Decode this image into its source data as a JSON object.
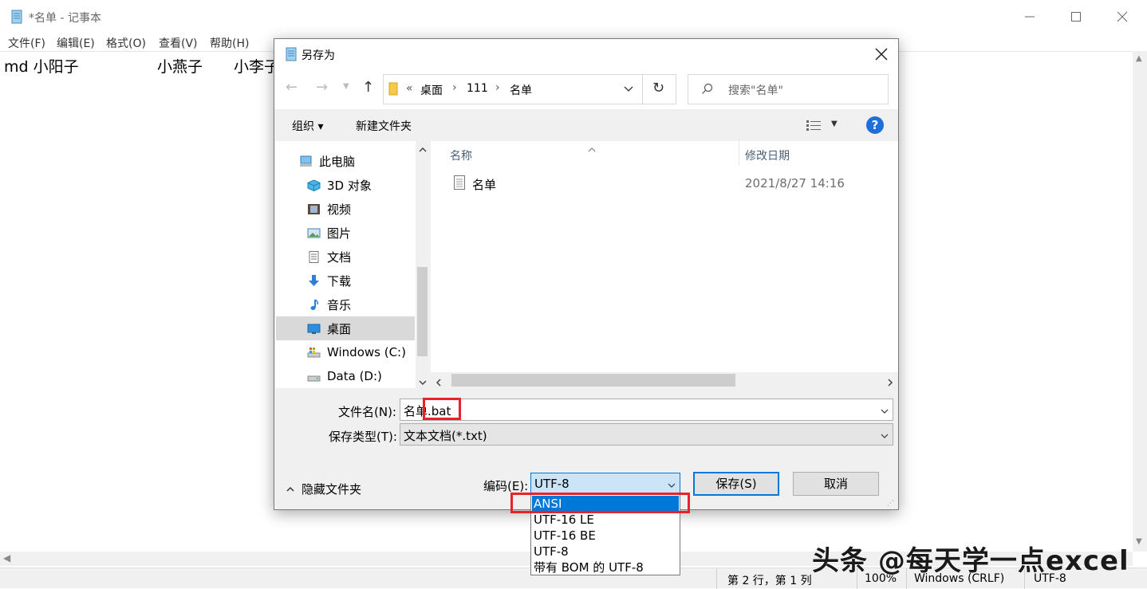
{
  "notepad": {
    "title": "*名单 - 记事本",
    "menu": [
      "文件(F)",
      "编辑(E)",
      "格式(O)",
      "查看(V)",
      "帮助(H)"
    ],
    "text_cells": [
      "md 小阳子",
      "小燕子",
      "小李子"
    ],
    "status": {
      "position": "第 2 行，第 1 列",
      "zoom": "100%",
      "line_ending": "Windows (CRLF)",
      "encoding": "UTF-8"
    }
  },
  "dialog": {
    "title": "另存为",
    "address": {
      "overflow": "«",
      "crumbs": [
        "桌面",
        "111",
        "名单"
      ]
    },
    "search_placeholder": "搜索\"名单\"",
    "toolbar": {
      "organize": "组织 ▾",
      "new_folder": "新建文件夹"
    },
    "nav_items": [
      {
        "label": "此电脑",
        "icon": "computer-icon"
      },
      {
        "label": "3D 对象",
        "icon": "cube-3d-icon"
      },
      {
        "label": "视频",
        "icon": "video-icon"
      },
      {
        "label": "图片",
        "icon": "picture-icon"
      },
      {
        "label": "文档",
        "icon": "document-icon"
      },
      {
        "label": "下载",
        "icon": "download-icon"
      },
      {
        "label": "音乐",
        "icon": "music-icon"
      },
      {
        "label": "桌面",
        "icon": "desktop-icon"
      },
      {
        "label": "Windows (C:)",
        "icon": "drive-c-icon"
      },
      {
        "label": "Data (D:)",
        "icon": "drive-d-icon"
      }
    ],
    "selected_nav": "桌面",
    "columns": {
      "name": "名称",
      "modified": "修改日期"
    },
    "files": [
      {
        "name": "名单",
        "modified": "2021/8/27 14:16"
      }
    ],
    "filename_label": "文件名(N):",
    "filename_value": "名单.bat",
    "filename_value_parts": [
      "名单",
      ".bat"
    ],
    "filetype_label": "保存类型(T):",
    "filetype_value": "文本文档(*.txt)",
    "hide_folders": "隐藏文件夹",
    "encoding_label": "编码(E):",
    "encoding_value": "UTF-8",
    "encoding_options": [
      "ANSI",
      "UTF-16 LE",
      "UTF-16 BE",
      "UTF-8",
      "带有 BOM 的 UTF-8"
    ],
    "highlighted_option": "ANSI",
    "save_button": "保存(S)",
    "cancel_button": "取消"
  },
  "watermark": "头条 @每天学一点excel",
  "colors": {
    "accent": "#0078d7",
    "highlight_box": "#e8212b",
    "help_icon": "#1e6fd9"
  }
}
